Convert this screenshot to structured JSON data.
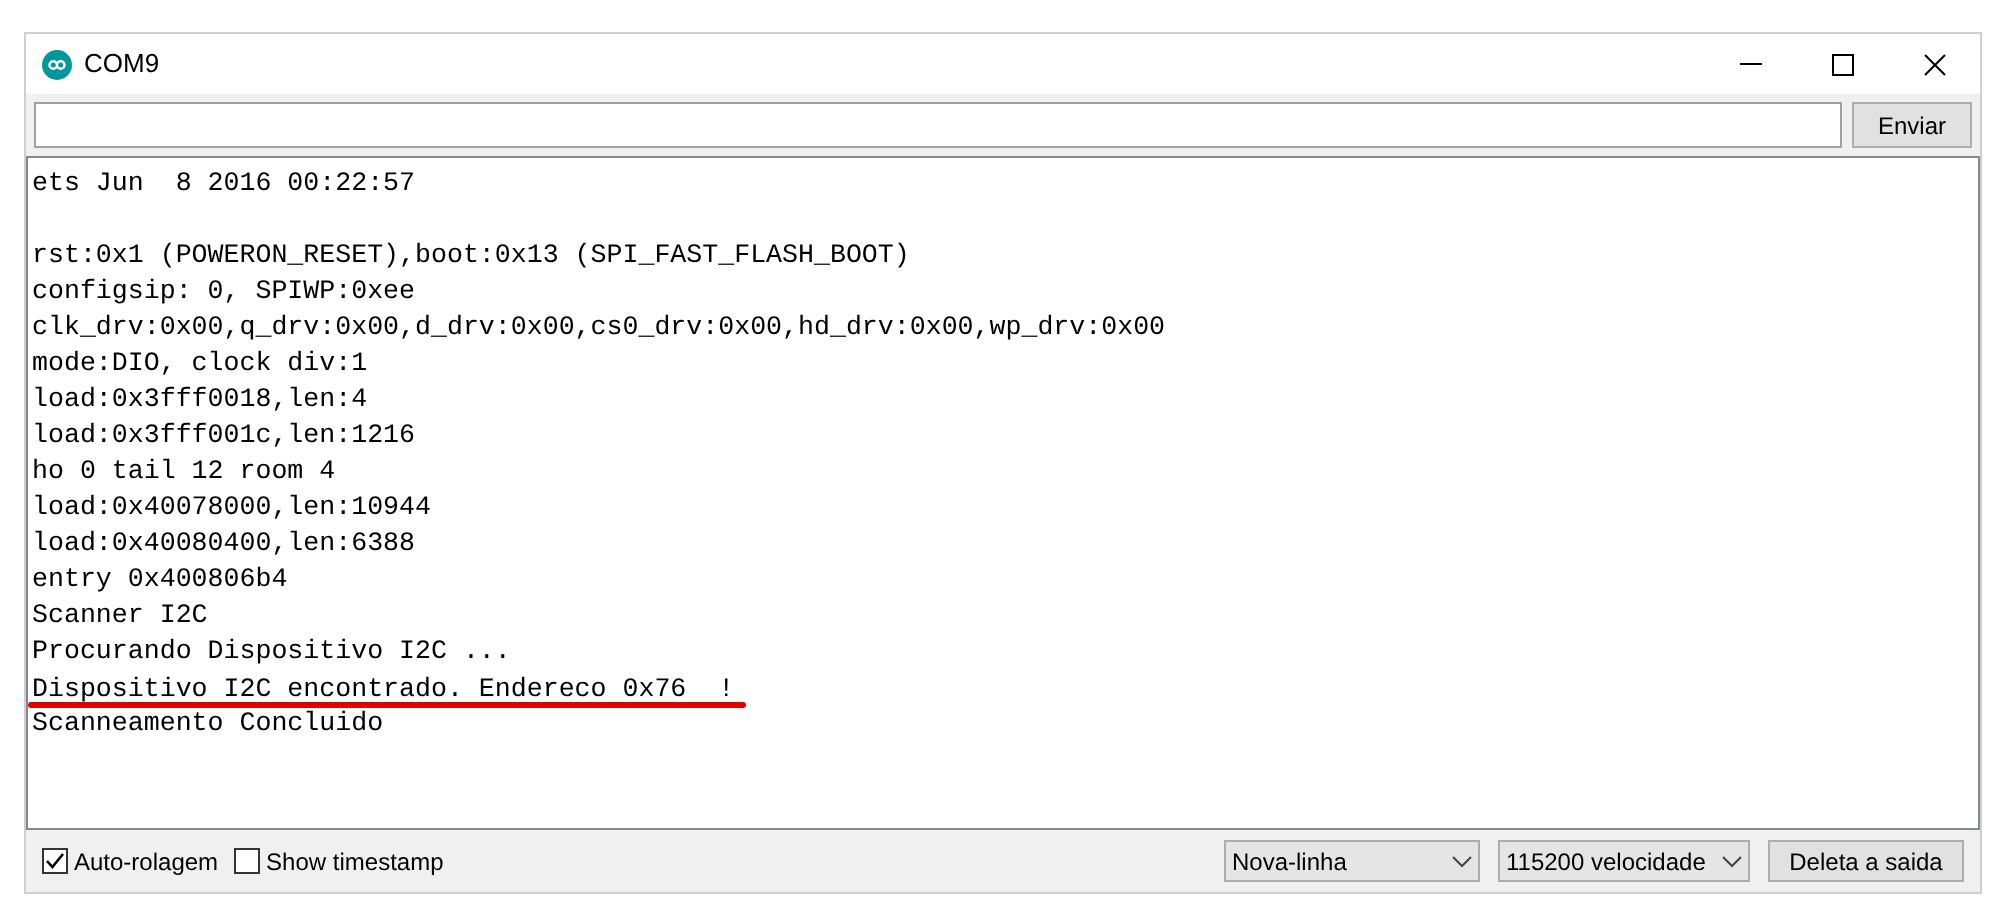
{
  "window": {
    "title": "COM9"
  },
  "send_button": "Enviar",
  "output_lines": [
    {
      "kind": "text",
      "text": "ets Jun  8 2016 00:22:57",
      "underlined": false
    },
    {
      "kind": "blank"
    },
    {
      "kind": "text",
      "text": "rst:0x1 (POWERON_RESET),boot:0x13 (SPI_FAST_FLASH_BOOT)",
      "underlined": false
    },
    {
      "kind": "text",
      "text": "configsip: 0, SPIWP:0xee",
      "underlined": false
    },
    {
      "kind": "text",
      "text": "clk_drv:0x00,q_drv:0x00,d_drv:0x00,cs0_drv:0x00,hd_drv:0x00,wp_drv:0x00",
      "underlined": false
    },
    {
      "kind": "text",
      "text": "mode:DIO, clock div:1",
      "underlined": false
    },
    {
      "kind": "text",
      "text": "load:0x3fff0018,len:4",
      "underlined": false
    },
    {
      "kind": "text",
      "text": "load:0x3fff001c,len:1216",
      "underlined": false
    },
    {
      "kind": "text",
      "text": "ho 0 tail 12 room 4",
      "underlined": false
    },
    {
      "kind": "text",
      "text": "load:0x40078000,len:10944",
      "underlined": false
    },
    {
      "kind": "text",
      "text": "load:0x40080400,len:6388",
      "underlined": false
    },
    {
      "kind": "text",
      "text": "entry 0x400806b4",
      "underlined": false
    },
    {
      "kind": "text",
      "text": "Scanner I2C",
      "underlined": false
    },
    {
      "kind": "text",
      "text": "Procurando Dispositivo I2C ...",
      "underlined": false
    },
    {
      "kind": "text",
      "text": "Dispositivo I2C encontrado. Endereco 0x76  !",
      "underlined": true
    },
    {
      "kind": "text",
      "text": "Scanneamento Concluido",
      "underlined": false
    }
  ],
  "options": [
    {
      "label": "Auto-rolagem",
      "checked": true
    },
    {
      "label": "Show timestamp",
      "checked": false
    }
  ],
  "dropdowns": [
    "Nova-linha",
    "115200 velocidade"
  ],
  "clear_button": "Deleta a saida"
}
